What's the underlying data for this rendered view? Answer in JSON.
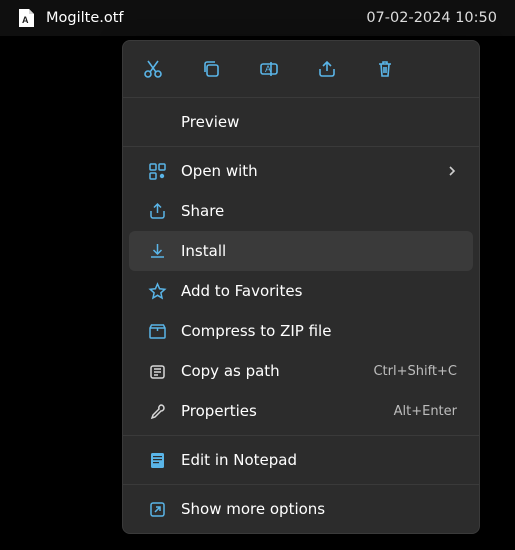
{
  "file": {
    "name": "Mogilte.otf",
    "date": "07-02-2024 10:50"
  },
  "menu": {
    "preview": "Preview",
    "open_with": "Open with",
    "share": "Share",
    "install": "Install",
    "favorites": "Add to Favorites",
    "compress": "Compress to ZIP file",
    "copy_path": "Copy as path",
    "copy_path_shortcut": "Ctrl+Shift+C",
    "properties": "Properties",
    "properties_shortcut": "Alt+Enter",
    "edit_notepad": "Edit in Notepad",
    "more_options": "Show more options"
  }
}
